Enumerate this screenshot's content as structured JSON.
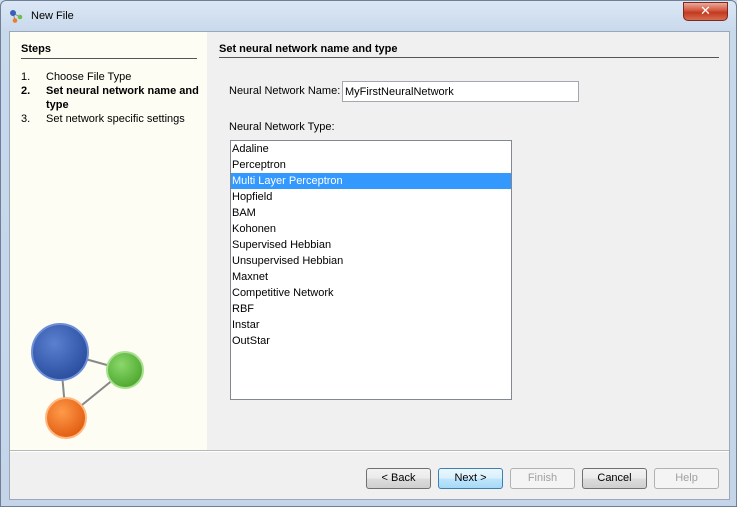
{
  "window": {
    "title": "New File",
    "close_icon": "close-icon"
  },
  "steps": {
    "heading": "Steps",
    "items": [
      {
        "num": "1.",
        "label": "Choose File Type"
      },
      {
        "num": "2.",
        "label": "Set neural network name and type"
      },
      {
        "num": "3.",
        "label": "Set network specific settings"
      }
    ],
    "active_index": 1
  },
  "page": {
    "title": "Set neural network name and type",
    "name_label": "Neural Network Name:",
    "name_value": "MyFirstNeuralNetwork",
    "type_label": "Neural Network Type:",
    "types": [
      "Adaline",
      "Perceptron",
      "Multi Layer Perceptron",
      "Hopfield",
      "BAM",
      "Kohonen",
      "Supervised Hebbian",
      "Unsupervised Hebbian",
      "Maxnet",
      "Competitive Network",
      "RBF",
      "Instar",
      "OutStar"
    ],
    "selected_type": "Multi Layer Perceptron"
  },
  "buttons": {
    "back": "< Back",
    "next": "Next >",
    "finish": "Finish",
    "cancel": "Cancel",
    "help": "Help"
  },
  "colors": {
    "selection": "#3399ff",
    "logo_blue": "#3a5fb6",
    "logo_green": "#6cc04a",
    "logo_orange": "#f07a25"
  }
}
